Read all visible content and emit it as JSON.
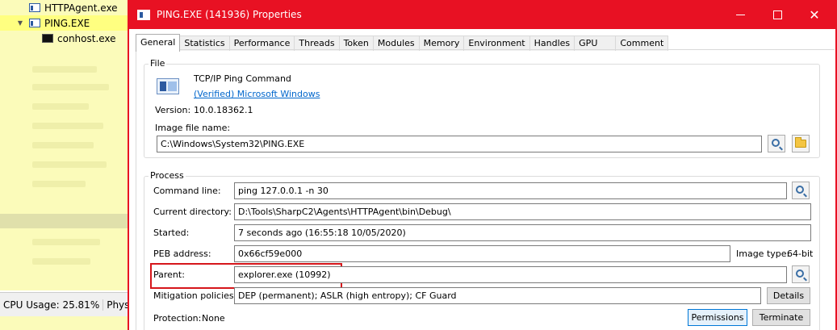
{
  "background_tree": {
    "items": [
      {
        "label": "HTTPAgent.exe",
        "icon": "app-window-icon"
      },
      {
        "label": "PING.EXE",
        "icon": "app-window-icon"
      },
      {
        "label": "conhost.exe",
        "icon": "console-icon"
      }
    ],
    "statusbar": {
      "cpu_usage": "CPU Usage: 25.81%",
      "physical": "Physical m"
    }
  },
  "dialog": {
    "title": "PING.EXE (141936) Properties",
    "tabs": [
      "General",
      "Statistics",
      "Performance",
      "Threads",
      "Token",
      "Modules",
      "Memory",
      "Environment",
      "Handles",
      "GPU",
      "Comment"
    ],
    "active_tab": "General",
    "file": {
      "group_label": "File",
      "description": "TCP/IP Ping Command",
      "verified_company": "(Verified) Microsoft Windows",
      "version_label": "Version:",
      "version_value": "10.0.18362.1",
      "image_file_name_label": "Image file name:",
      "image_file_name_value": "C:\\Windows\\System32\\PING.EXE"
    },
    "process": {
      "group_label": "Process",
      "command_line_label": "Command line:",
      "command_line_value": "ping 127.0.0.1 -n 30",
      "current_directory_label": "Current directory:",
      "current_directory_value": "D:\\Tools\\SharpC2\\Agents\\HTTPAgent\\bin\\Debug\\",
      "started_label": "Started:",
      "started_value": "7 seconds ago (16:55:18 10/05/2020)",
      "peb_address_label": "PEB address:",
      "peb_address_value": "0x66cf59e000",
      "image_type_label": "Image type:",
      "image_type_value": "64-bit",
      "parent_label": "Parent:",
      "parent_value": "explorer.exe (10992)",
      "mitigation_label": "Mitigation policies:",
      "mitigation_value": "DEP (permanent); ASLR (high entropy); CF Guard",
      "details_button": "Details",
      "protection_label": "Protection:",
      "protection_value": "None",
      "permissions_button": "Permissions",
      "terminate_button": "Terminate"
    }
  },
  "colors": {
    "titlebar": "#e81123",
    "highlight_box": "#d6161b",
    "link": "#0066cc",
    "tree_background": "#fbfbba"
  }
}
